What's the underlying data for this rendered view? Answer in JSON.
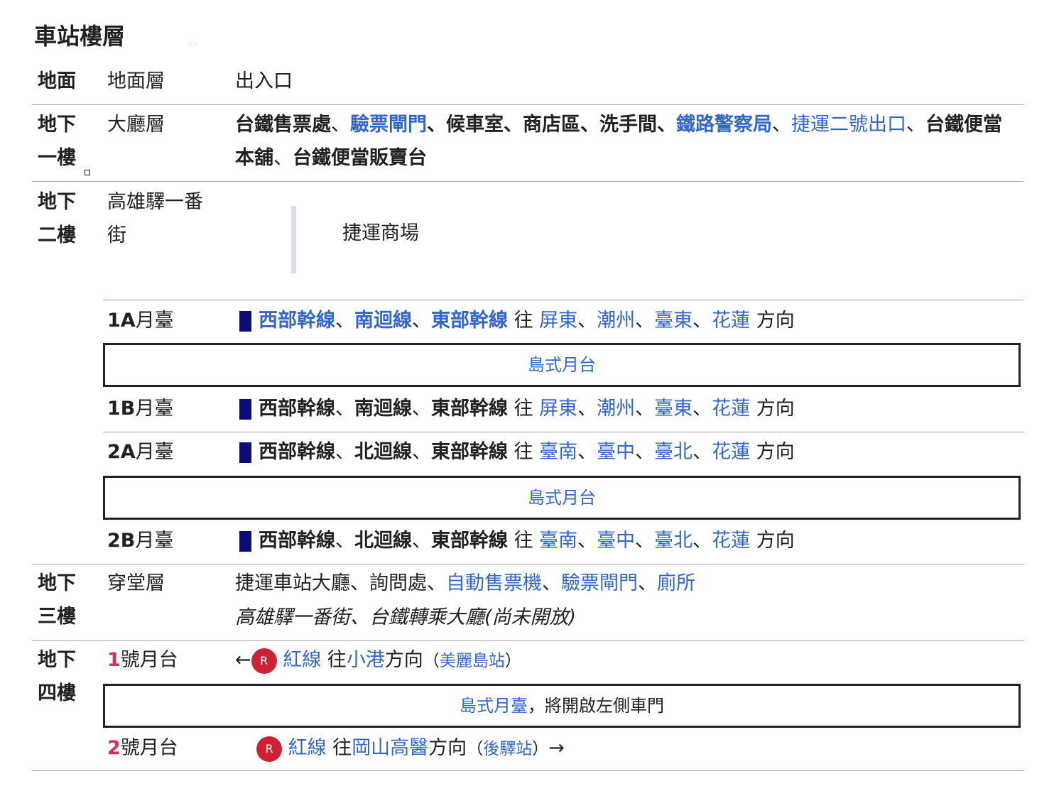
{
  "title": "車站樓層",
  "floors": {
    "ground": {
      "label": "地面",
      "layer": "地面層",
      "desc": "出入口"
    },
    "b1": {
      "label": "地下一樓",
      "layer": "大廳層",
      "items": [
        {
          "text": "台鐵售票處",
          "style": "bold"
        },
        {
          "text": "、",
          "style": "plain"
        },
        {
          "text": "驗票閘門",
          "style": "bold-link"
        },
        {
          "text": "、候車室、商店區、洗手間、",
          "style": "bold"
        },
        {
          "text": "鐵路警察局",
          "style": "bold-link"
        },
        {
          "text": "、",
          "style": "plain"
        },
        {
          "text": "捷運二號出口",
          "style": "link"
        },
        {
          "text": "、",
          "style": "plain"
        },
        {
          "text": "台鐵便當本舖",
          "style": "bold"
        },
        {
          "text": "、",
          "style": "plain"
        },
        {
          "text": "台鐵便當販賣台",
          "style": "bold"
        }
      ]
    },
    "b2": {
      "label": "地下二樓",
      "layer": "高雄驛一番街",
      "mall": "捷運商場",
      "platforms": [
        {
          "code": "1A",
          "suffix": "月臺",
          "lines": [
            "西部幹線",
            "南迴線",
            "東部幹線"
          ],
          "lines_linked": true,
          "towards": "往",
          "destinations": [
            "屏東",
            "潮州",
            "臺東",
            "花蓮"
          ],
          "direction": "方向"
        },
        {
          "code": "1B",
          "suffix": "月臺",
          "lines": [
            "西部幹線",
            "南迴線",
            "東部幹線"
          ],
          "lines_linked": false,
          "towards": "往",
          "destinations": [
            "屏東",
            "潮州",
            "臺東",
            "花蓮"
          ],
          "direction": "方向"
        },
        {
          "code": "2A",
          "suffix": "月臺",
          "lines": [
            "西部幹線",
            "北迴線",
            "東部幹線"
          ],
          "lines_linked": false,
          "towards": "往",
          "destinations": [
            "臺南",
            "臺中",
            "臺北",
            "花蓮"
          ],
          "direction": "方向"
        },
        {
          "code": "2B",
          "suffix": "月臺",
          "lines": [
            "西部幹線",
            "北迴線",
            "東部幹線"
          ],
          "lines_linked": false,
          "towards": "往",
          "destinations": [
            "臺南",
            "臺中",
            "臺北",
            "花蓮"
          ],
          "direction": "方向"
        }
      ],
      "island_label": "島式月台"
    },
    "b3": {
      "label": "地下三樓",
      "layer": "穿堂層",
      "line1_plain": "捷運車站大廳、詢問處、",
      "line1_links": [
        "自動售票機",
        "驗票閘門",
        "廁所"
      ],
      "line2_italic": "高雄驛一番街、台鐵轉乘大廳(尚未開放)"
    },
    "b4": {
      "label": "地下四樓",
      "platforms": [
        {
          "num": "1",
          "suffix": "號月台",
          "arrow_left": "←",
          "arrow_right": "",
          "badge": "R",
          "line": "紅線",
          "towards": "往",
          "dest": "小港",
          "direction": "方向",
          "station": "美麗島站"
        },
        {
          "num": "2",
          "suffix": "號月台",
          "arrow_left": "",
          "arrow_right": "→",
          "badge": "R",
          "line": "紅線",
          "towards": "往",
          "dest": "岡山高醫",
          "direction": "方向",
          "station": "後驛站"
        }
      ],
      "island_link": "島式月臺",
      "island_text": "，將開啟左側車門"
    }
  },
  "colors": {
    "link": "#3366cc",
    "rail_swatch": "#0b0b7a",
    "red_line": "#cc2233",
    "platform_num": "#d42e61"
  }
}
